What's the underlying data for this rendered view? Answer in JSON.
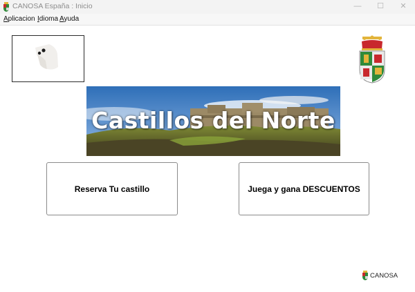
{
  "window": {
    "title": "CANOSA España : Inicio",
    "controls": {
      "minimize": "—",
      "maximize": "☐",
      "close": "✕"
    }
  },
  "menu": [
    {
      "accel": "A",
      "rest": "plicacion"
    },
    {
      "accel": "I",
      "rest": "dioma"
    },
    {
      "accel": "A",
      "rest": "yuda"
    }
  ],
  "banner": {
    "title": "Castillos del Norte"
  },
  "buttons": {
    "reserve": "Reserva Tu castillo",
    "play": "Juega y gana DESCUENTOS"
  },
  "footer": {
    "brand": "CANOSA"
  },
  "colors": {
    "crest_red": "#c8282d",
    "crest_green": "#2f8a3a",
    "crest_gold": "#e2b43b",
    "sky": "#4d86c7"
  }
}
